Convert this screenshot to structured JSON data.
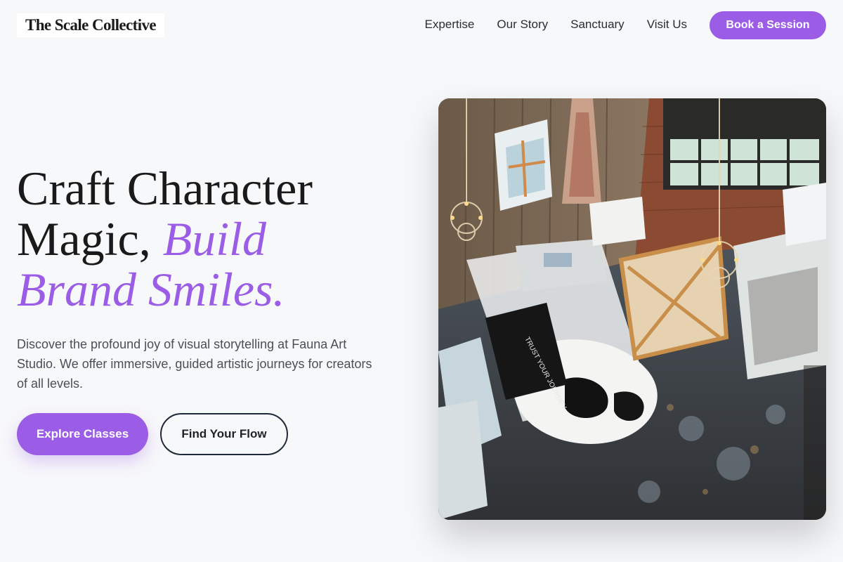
{
  "nav": {
    "logo": "The Scale Collective",
    "links": [
      "Expertise",
      "Our Story",
      "Sanctuary",
      "Visit Us"
    ],
    "cta": "Book a Session"
  },
  "hero": {
    "headline_part1": "Craft Character Magic, ",
    "headline_accent": "Build Brand Smiles",
    "headline_end": ".",
    "lead": "Discover the profound joy of visual storytelling at Fauna Art Studio. We offer immersive, guided artistic journeys for creators of all levels.",
    "primary_cta": "Explore Classes",
    "secondary_cta": "Find Your Flow",
    "image_alt": "Art studio loft with canvases, chandeliers and paint-splattered floor",
    "sign_text": "TRUST YOUR JOURNEY"
  },
  "colors": {
    "accent": "#9b5de5",
    "background": "#f7f8fa",
    "text": "#1f2328"
  }
}
